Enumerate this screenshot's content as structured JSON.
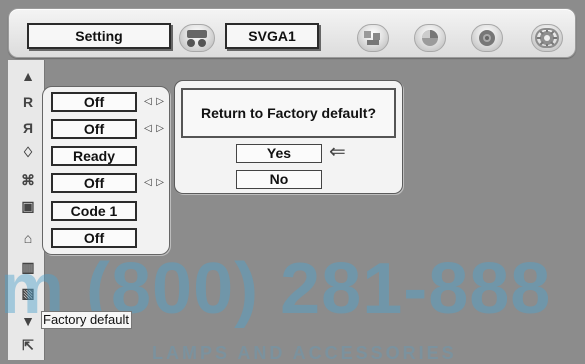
{
  "header": {
    "menu_label": "Setting",
    "source_label": "SVGA1",
    "icons": [
      "input-source-icon",
      "pc-adjust-icon",
      "color-icon",
      "sound-icon",
      "setting-icon"
    ]
  },
  "sidebar": {
    "icons": [
      "up-arrow-icon",
      "ceiling-icon",
      "rear-icon",
      "lamp-icon",
      "screen-icon",
      "remote-icon",
      "security-icon",
      "filter-icon",
      "reset-icon",
      "down-arrow-icon",
      "exit-icon"
    ]
  },
  "menu": {
    "items": [
      {
        "value": "Off",
        "has_arrows": true
      },
      {
        "value": "Off",
        "has_arrows": true
      },
      {
        "value": "Ready",
        "has_arrows": false
      },
      {
        "value": "Off",
        "has_arrows": true
      },
      {
        "value": "Code 1",
        "has_arrows": false
      },
      {
        "value": "Off",
        "has_arrows": false
      }
    ]
  },
  "dialog": {
    "question": "Return to Factory default?",
    "yes": "Yes",
    "no": "No"
  },
  "tooltip": {
    "text": "Factory default"
  },
  "watermark": {
    "text": "m (800) 281-888",
    "subtext": "LAMPS AND ACCESSORIES"
  },
  "colors": {
    "background": "#8c8c8c",
    "panel": "#f2f2f2",
    "text": "#111111",
    "watermark": "#4ea2cb"
  }
}
